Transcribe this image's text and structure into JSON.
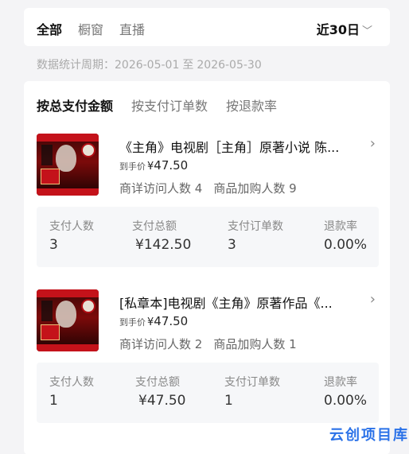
{
  "tabs": {
    "all": "全部",
    "window": "橱窗",
    "live": "直播"
  },
  "range": {
    "label": "近30日",
    "chevron": "﹀"
  },
  "period": {
    "label": "数据统计周期：",
    "start": "2026-05-01",
    "sep": "至",
    "end": "2026-05-30"
  },
  "sort": {
    "by_amount": "按总支付金额",
    "by_orders": "按支付订单数",
    "by_refund": "按退款率"
  },
  "stat_labels": {
    "buyers": "支付人数",
    "amount": "支付总额",
    "orders": "支付订单数",
    "refund": "退款率"
  },
  "products": [
    {
      "title": "《主角》电视剧［主角］原著小说 陈...",
      "price_label": "到手价",
      "currency": "¥",
      "price": "47.50",
      "visits": "商详访问人数 4",
      "carts": "商品加购人数 9",
      "buyers": "3",
      "amount": "¥142.50",
      "orders": "3",
      "refund": "0.00%"
    },
    {
      "title": "[私章本]电视剧《主角》原著作品《...",
      "price_label": "到手价",
      "currency": "¥",
      "price": "47.50",
      "visits": "商详访问人数 2",
      "carts": "商品加购人数 1",
      "buyers": "1",
      "amount": "¥47.50",
      "orders": "1",
      "refund": "0.00%"
    }
  ],
  "watermark": "云创项目库"
}
